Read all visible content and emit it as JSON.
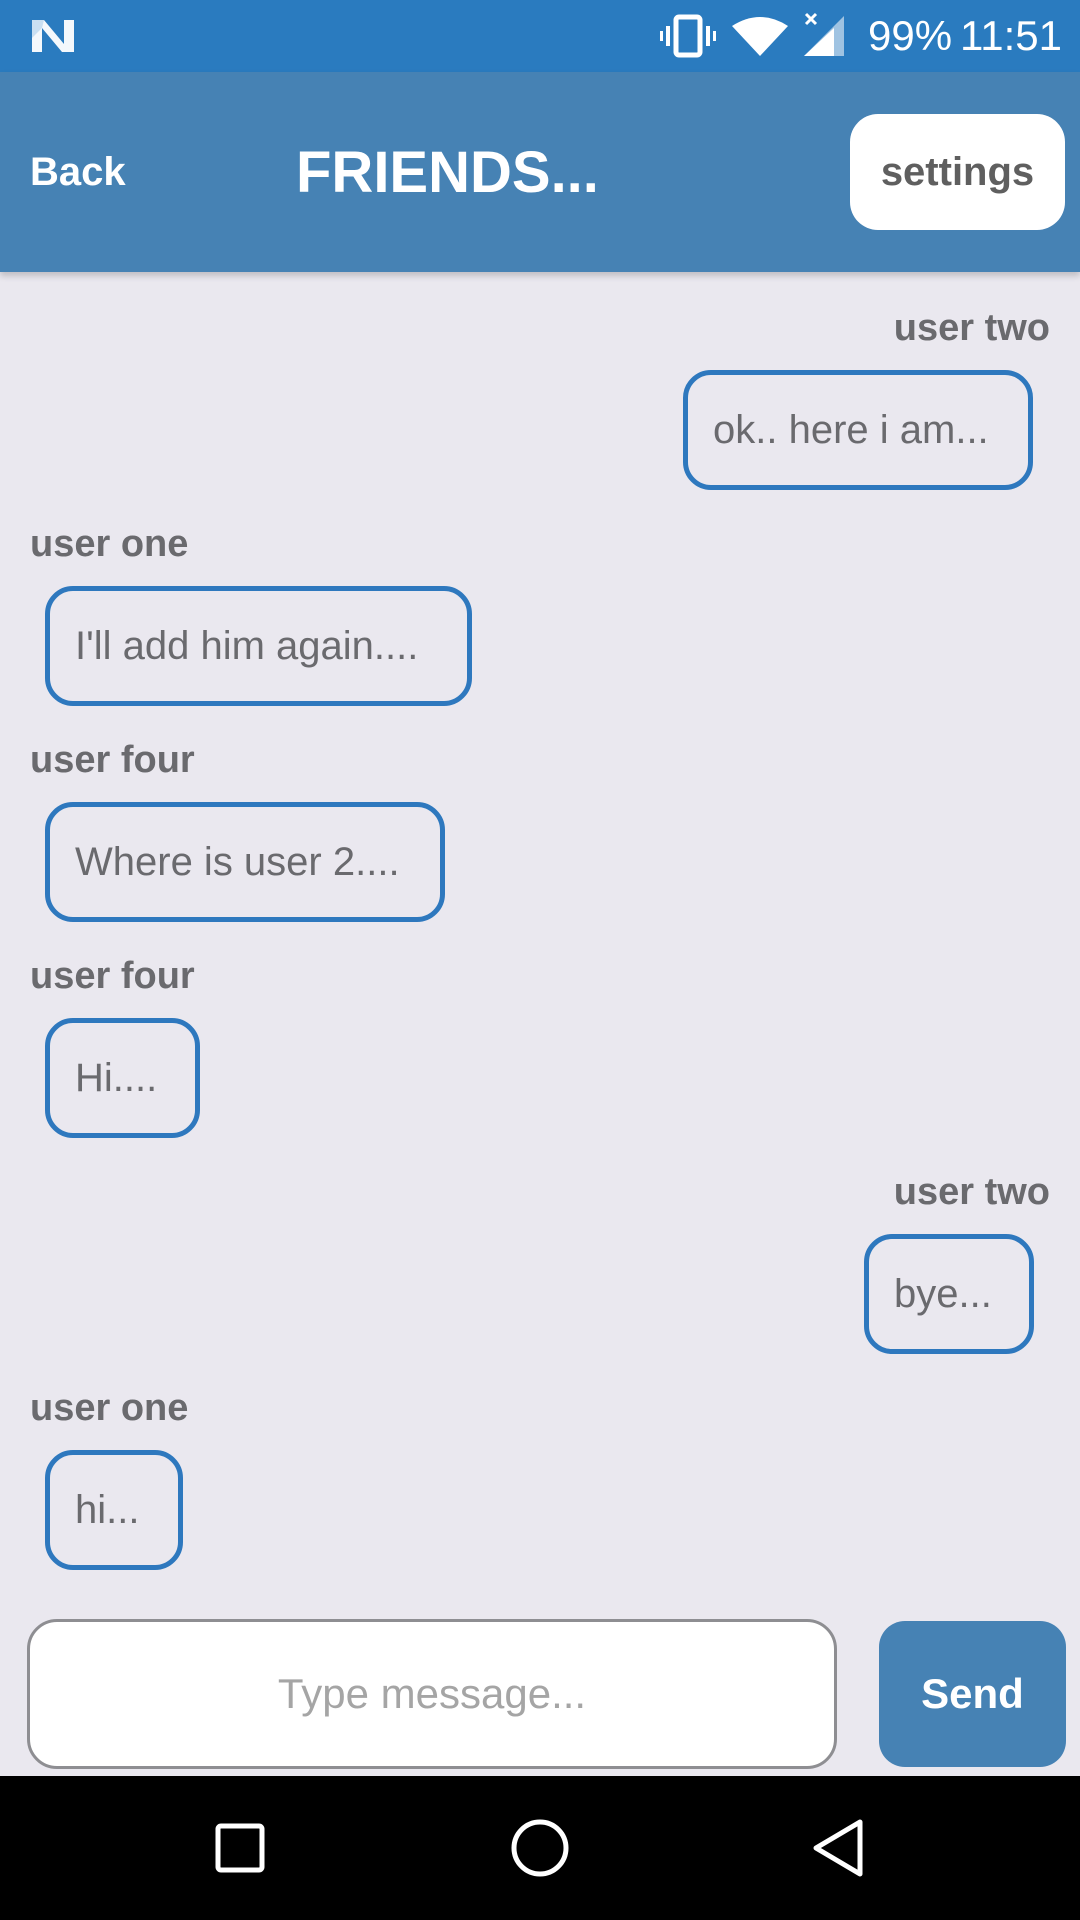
{
  "status_bar": {
    "battery": "99%",
    "time": "11:51",
    "icons": [
      "n-logo-icon",
      "vibrate-icon",
      "wifi-icon",
      "signal-icon"
    ]
  },
  "header": {
    "back_label": "Back",
    "title": "FRIENDS...",
    "settings_label": "settings"
  },
  "messages": [
    {
      "sender": "user two",
      "text": "ok.. here i am...",
      "side": "right"
    },
    {
      "sender": "user one",
      "text": "I'll add him again....",
      "side": "left"
    },
    {
      "sender": "user four",
      "text": "Where is user 2....",
      "side": "left"
    },
    {
      "sender": "user four",
      "text": "Hi....",
      "side": "left"
    },
    {
      "sender": "user two",
      "text": "bye...",
      "side": "right"
    },
    {
      "sender": "user one",
      "text": "hi...",
      "side": "left"
    }
  ],
  "composer": {
    "placeholder": "Type message...",
    "value": "",
    "send_label": "Send"
  },
  "nav_bar": {
    "icons": [
      "recents-square-icon",
      "home-circle-icon",
      "back-triangle-icon"
    ]
  },
  "colors": {
    "status_bar": "#2A7BBF",
    "header": "#4682B4",
    "background": "#EAE8EF",
    "bubble_border": "#2E78BE",
    "send_button": "#4682B4"
  }
}
